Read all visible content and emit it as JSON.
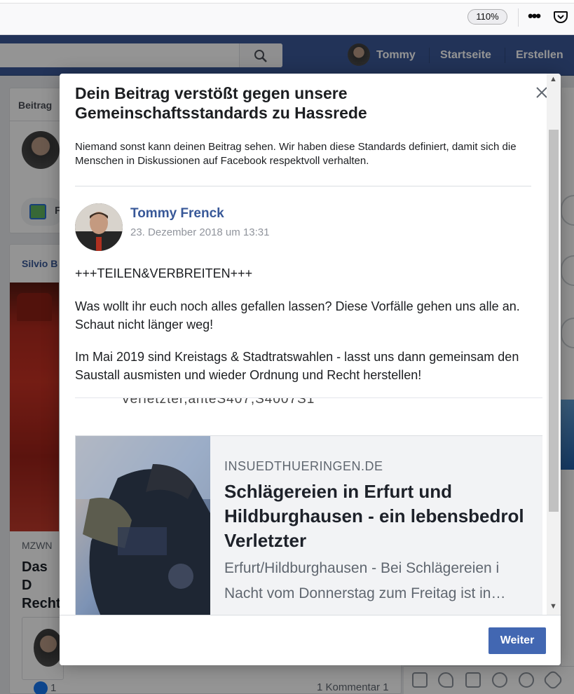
{
  "browser": {
    "zoom": "110%",
    "menu_icon": "more-dots-icon",
    "pocket_icon": "pocket-icon"
  },
  "header": {
    "user_name": "Tommy",
    "home_label": "Startseite",
    "create_label": "Erstellen",
    "brand_color": "#3b5998"
  },
  "background": {
    "composer_tab": "Beitrag",
    "photo_label": "F",
    "post_author_fragment": "Silvio B",
    "link_meta_fragment": "MZWN",
    "link_title_fragment": "Das D Recht",
    "likes_count": "1",
    "comments": "1 Kommentar  1"
  },
  "modal": {
    "title": "Dein Beitrag verstößt gegen unsere Gemeinschaftsstandards zu Hassrede",
    "description": "Niemand sonst kann deinen Beitrag sehen. Wir haben diese Standards definiert, damit sich die Menschen in Diskussionen auf Facebook respektvoll verhalten.",
    "post": {
      "author": "Tommy Frenck",
      "date": "23. Dezember 2018 um 13:31",
      "paragraphs": [
        "+++TEILEN&VERBREITEN+++",
        "Was wollt ihr euch noch alles gefallen lassen? Diese Vorfälle gehen uns alle an. Schaut nicht länger weg!",
        "Im Mai 2019 sind Kreistags & Stadtratswahlen - lasst uns dann gemeinsam den Saustall ausmisten und wieder Ordnung und Recht herstellen!"
      ],
      "image_text_fragment": "Verletzter,anteS407,S4007S1"
    },
    "link": {
      "domain": "INSUEDTHUERINGEN.DE",
      "headline_line1": "Schlägereien in Erfurt und",
      "headline_line2": "Hildburghausen - ein lebensbedrol",
      "headline_line3": "Verletzter",
      "desc_line1": "Erfurt/Hildburghausen - Bei Schlägereien i",
      "desc_line2": "Nacht vom Donnerstag zum Freitag ist in…"
    },
    "continue_label": "Weiter",
    "button_color": "#4267b2"
  }
}
